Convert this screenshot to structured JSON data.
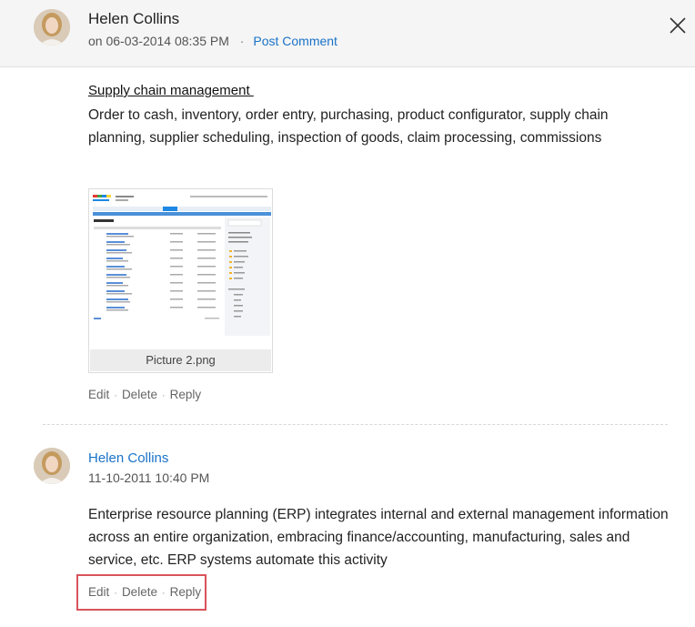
{
  "header": {
    "author": "Helen Collins",
    "on_label": "on",
    "datetime": "06-03-2014 08:35 PM",
    "separator": "·",
    "post_comment_label": "Post Comment",
    "close_icon": "close-icon"
  },
  "post": {
    "title": "Supply chain management ",
    "body": "Order to cash, inventory, order entry, purchasing, product configurator, supply chain planning, supplier scheduling, inspection of goods, claim processing, commissions",
    "attachment": {
      "caption": "Picture 2.png",
      "thumb_title": "Documents"
    },
    "actions": {
      "edit": "Edit",
      "delete": "Delete",
      "reply": "Reply",
      "separator": "·"
    }
  },
  "comment": {
    "author": "Helen Collins",
    "datetime": "11-10-2011 10:40 PM",
    "body": "Enterprise resource planning (ERP) integrates internal and external management information across an entire organization, embracing finance/accounting, manufacturing, sales and service, etc. ERP systems automate this activity",
    "actions": {
      "edit": "Edit",
      "delete": "Delete",
      "reply": "Reply",
      "separator": "·"
    }
  },
  "colors": {
    "link": "#1a73c8",
    "highlight": "#d9535a",
    "header_bg": "#f5f5f5"
  }
}
